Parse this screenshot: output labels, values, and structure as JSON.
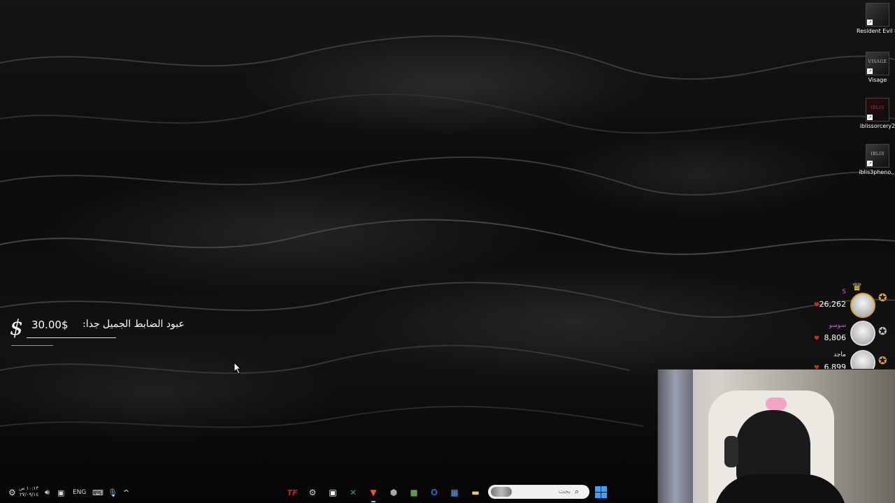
{
  "desktop_icons": [
    {
      "label": "Resident Evil Requiem",
      "icon": "resident-evil-requiem-icon"
    },
    {
      "label": "Visage",
      "icon": "visage-icon",
      "thumb_text": "VISAGE"
    },
    {
      "label": "iblissorcery2",
      "icon": "iblis-sorcery-icon",
      "thumb_text": "IBLIS"
    },
    {
      "label": "iblis3pheno...",
      "icon": "iblis3pheno-icon",
      "thumb_text": "IBLIS"
    }
  ],
  "donation_alert": {
    "currency_symbol": "$",
    "amount": "30.00$",
    "message": "عبود الضابط الجميل جدا:"
  },
  "leaderboard": [
    {
      "name": "S",
      "score": "26,262",
      "rank_medal": "gold",
      "crown": true
    },
    {
      "name": "سوسو",
      "score": "8,806",
      "rank_medal": "silver",
      "crown": false
    },
    {
      "name": "ماجد",
      "score": "6,899",
      "rank_medal": "bronze",
      "crown": false
    }
  ],
  "taskbar": {
    "clock_time": "١٠:١٣ ص",
    "clock_date": "٢٧/٠٩/١٤",
    "language": "ENG",
    "search_placeholder": "بحث",
    "tray_icons": [
      "settings-icon",
      "speaker-icon",
      "network-icon",
      "keyboard-icon",
      "microphone-icon",
      "chevron-up-icon"
    ],
    "app_icons": [
      {
        "name": "teamfight-tactics-icon",
        "glyph": "TF",
        "color": "#c0212a"
      },
      {
        "name": "steam-icon",
        "glyph": "⚙",
        "color": "#c7d5e0"
      },
      {
        "name": "capcut-icon",
        "glyph": "▣",
        "color": "#ffffff"
      },
      {
        "name": "excel-icon",
        "glyph": "✕",
        "color": "#21a366"
      },
      {
        "name": "brave-browser-icon",
        "glyph": "▼",
        "color": "#fb542b"
      },
      {
        "name": "settings-hex-icon",
        "glyph": "⬢",
        "color": "#a8a8a8"
      },
      {
        "name": "minecraft-icon",
        "glyph": "■",
        "color": "#5c9c3a"
      },
      {
        "name": "outlook-icon",
        "glyph": "O",
        "color": "#0f6cbd"
      },
      {
        "name": "microsoft-store-icon",
        "glyph": "▦",
        "color": "#5aa9f2"
      },
      {
        "name": "file-explorer-icon",
        "glyph": "▬",
        "color": "#f7c948"
      }
    ]
  },
  "colors": {
    "leader_name": "#d05bd6",
    "heart": "#e0242c",
    "start_button": "#37a2ff"
  }
}
